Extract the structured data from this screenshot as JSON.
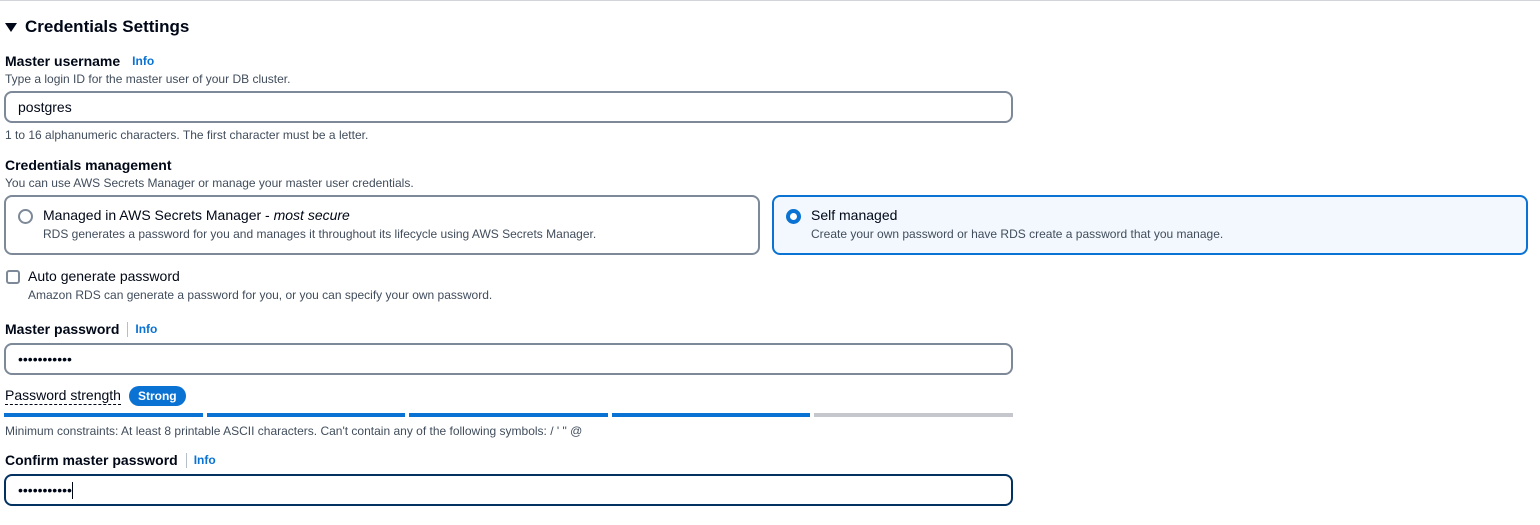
{
  "section": {
    "title": "Credentials Settings"
  },
  "master_username": {
    "label": "Master username",
    "info": "Info",
    "description": "Type a login ID for the master user of your DB cluster.",
    "value": "postgres",
    "constraint": "1 to 16 alphanumeric characters. The first character must be a letter."
  },
  "credentials_management": {
    "label": "Credentials management",
    "description": "You can use AWS Secrets Manager or manage your master user credentials.",
    "options": [
      {
        "title": "Managed in AWS Secrets Manager - ",
        "title_emphasis": "most secure",
        "description": "RDS generates a password for you and manages it throughout its lifecycle using AWS Secrets Manager.",
        "selected": false
      },
      {
        "title": "Self managed",
        "description": "Create your own password or have RDS create a password that you manage.",
        "selected": true
      }
    ]
  },
  "auto_generate": {
    "label": "Auto generate password",
    "description": "Amazon RDS can generate a password for you, or you can specify your own password.",
    "checked": false
  },
  "master_password": {
    "label": "Master password",
    "info": "Info",
    "value": "•••••••••••"
  },
  "password_strength": {
    "label": "Password strength",
    "badge": "Strong",
    "filled_segments": 4,
    "total_segments": 5,
    "constraint": "Minimum constraints: At least 8 printable ASCII characters. Can't contain any of the following symbols: / ' \" @"
  },
  "confirm_password": {
    "label": "Confirm master password",
    "info": "Info",
    "value": "•••••••••••"
  },
  "colors": {
    "accent": "#0972d3",
    "selected_tile_bg": "#f2f8fd",
    "text": "#000716",
    "muted_text": "#414d5c",
    "border": "#7d8998"
  }
}
